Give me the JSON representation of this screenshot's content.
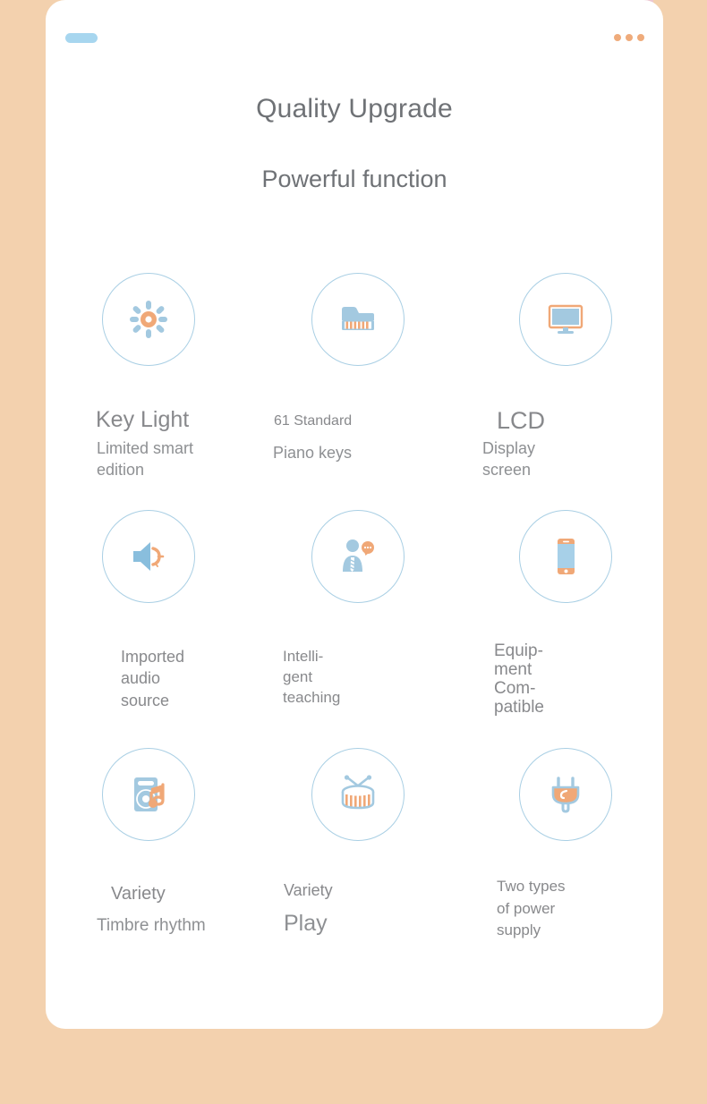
{
  "theme": {
    "page_background": "#f3d1ae",
    "card_background": "#ffffff",
    "accent_blue": "#a7d6ef",
    "accent_orange": "#efab7b",
    "icon_blue": "#a3c9e0",
    "icon_orange": "#f0a877",
    "circle_border": "#a9cfe4",
    "text_gray": "#8b8d90",
    "title_gray": "#6f7276"
  },
  "header": {
    "nav_pill_name": "nav-pill",
    "more_menu_dots": 3
  },
  "title": {
    "main": "Quality Upgrade",
    "sub": "Powerful function"
  },
  "features": [
    {
      "icon": "sun-light-icon",
      "name": "key-light",
      "line1": "Key Light",
      "line2": "Limited smart edition"
    },
    {
      "icon": "piano-icon",
      "name": "piano-keys",
      "line1": "61 Standard",
      "line2": "Piano keys"
    },
    {
      "icon": "monitor-icon",
      "name": "lcd-display",
      "line1": "LCD",
      "line2": "Display screen"
    },
    {
      "icon": "speaker-icon",
      "name": "imported-audio-source",
      "line1": "Imported\naudio\nsource",
      "line2": ""
    },
    {
      "icon": "person-speech-icon",
      "name": "intelligent-teaching",
      "line1": "Intelli-\ngent\nteaching",
      "line2": ""
    },
    {
      "icon": "smartphone-icon",
      "name": "equipment-compatible",
      "line1": "Equip-\nment\nCom-\npatible",
      "line2": ""
    },
    {
      "icon": "music-player-icon",
      "name": "timbre-rhythm",
      "line1": "Variety",
      "line2": "Timbre rhythm"
    },
    {
      "icon": "drum-icon",
      "name": "variety-play",
      "line1": "Variety",
      "line2": "Play"
    },
    {
      "icon": "power-plug-icon",
      "name": "two-types-power-supply",
      "line1": "Two types\nof power\nsupply",
      "line2": ""
    }
  ]
}
